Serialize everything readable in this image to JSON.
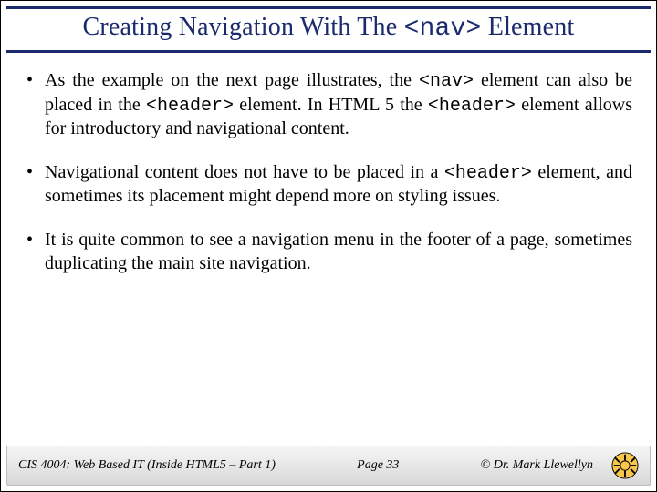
{
  "title": {
    "prefix": "Creating Navigation With The ",
    "code": "<nav>",
    "suffix": " Element"
  },
  "bullets": [
    {
      "parts": [
        {
          "t": "As the example on the next page illustrates, the "
        },
        {
          "t": "<nav>",
          "code": true
        },
        {
          "t": " element can also be placed in the "
        },
        {
          "t": "<header>",
          "code": true
        },
        {
          "t": " element.  In HTML 5 the "
        },
        {
          "t": "<header>",
          "code": true
        },
        {
          "t": " element allows for introductory and navigational content."
        }
      ]
    },
    {
      "parts": [
        {
          "t": "Navigational content does not have to be placed in a "
        },
        {
          "t": "<header>",
          "code": true
        },
        {
          "t": " element, and sometimes its placement might depend more on styling issues."
        }
      ]
    },
    {
      "parts": [
        {
          "t": "It is quite common to see a navigation menu in the footer of a page, sometimes duplicating the main site navigation."
        }
      ]
    }
  ],
  "footer": {
    "course": "CIS 4004: Web Based IT (Inside HTML5 – Part 1)",
    "page": "Page 33",
    "author": "© Dr. Mark Llewellyn"
  }
}
